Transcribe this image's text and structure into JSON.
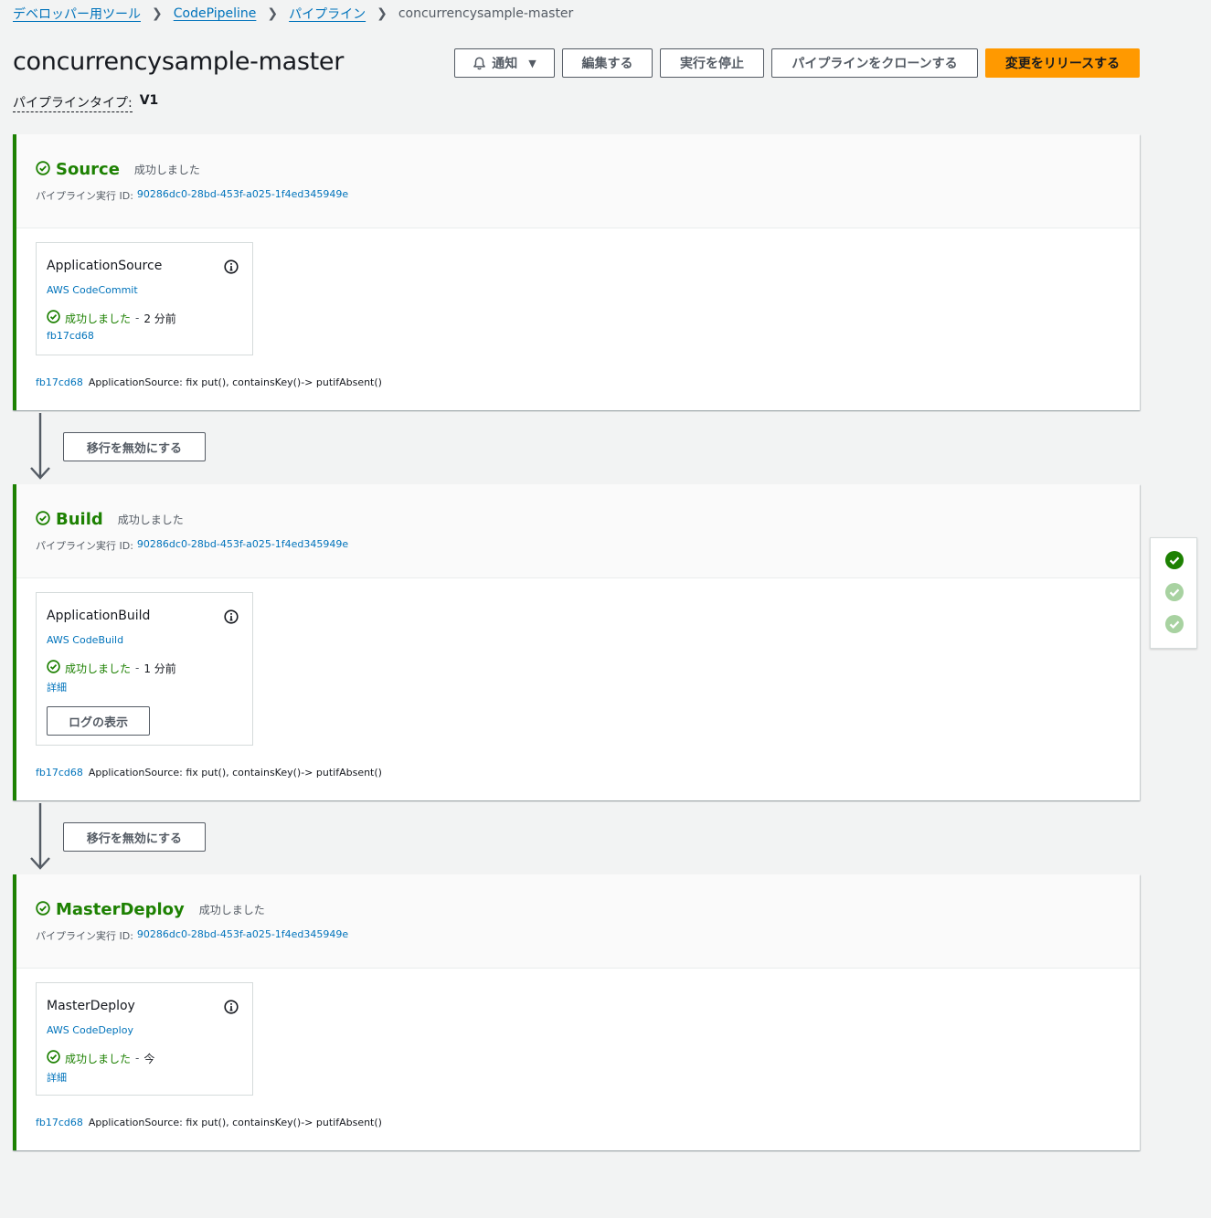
{
  "breadcrumb": {
    "items": [
      "デベロッパー用ツール",
      "CodePipeline",
      "パイプライン"
    ],
    "current": "concurrencysample-master"
  },
  "page": {
    "title": "concurrencysample-master",
    "pipeline_type_label": "パイプラインタイプ:",
    "pipeline_type_value": "V1"
  },
  "actions": {
    "notify": "通知",
    "edit": "編集する",
    "stop": "実行を停止",
    "clone": "パイプラインをクローンする",
    "release": "変更をリリースする"
  },
  "colors": {
    "success": "#1d8102",
    "primary": "#ff9900",
    "link": "#0073bb"
  },
  "exec_label": "パイプライン実行 ID:",
  "transition_label": "移行を無効にする",
  "stages": [
    {
      "name": "Source",
      "status": "成功しました",
      "exec_id": "90286dc0-28bd-453f-a025-1f4ed345949e",
      "action": {
        "name": "ApplicationSource",
        "provider": "AWS CodeCommit",
        "status": "成功しました",
        "time": "2 分前",
        "link": "fb17cd68"
      },
      "commit_id": "fb17cd68",
      "commit_msg": "ApplicationSource: fix put(), containsKey()-> putifAbsent()"
    },
    {
      "name": "Build",
      "status": "成功しました",
      "exec_id": "90286dc0-28bd-453f-a025-1f4ed345949e",
      "action": {
        "name": "ApplicationBuild",
        "provider": "AWS CodeBuild",
        "status": "成功しました",
        "time": "1 分前",
        "link": "詳細",
        "log_button": "ログの表示"
      },
      "commit_id": "fb17cd68",
      "commit_msg": "ApplicationSource: fix put(), containsKey()-> putifAbsent()"
    },
    {
      "name": "MasterDeploy",
      "status": "成功しました",
      "exec_id": "90286dc0-28bd-453f-a025-1f4ed345949e",
      "action": {
        "name": "MasterDeploy",
        "provider": "AWS CodeDeploy",
        "status": "成功しました",
        "time": "今",
        "link": "詳細"
      },
      "commit_id": "fb17cd68",
      "commit_msg": "ApplicationSource: fix put(), containsKey()-> putifAbsent()"
    }
  ]
}
